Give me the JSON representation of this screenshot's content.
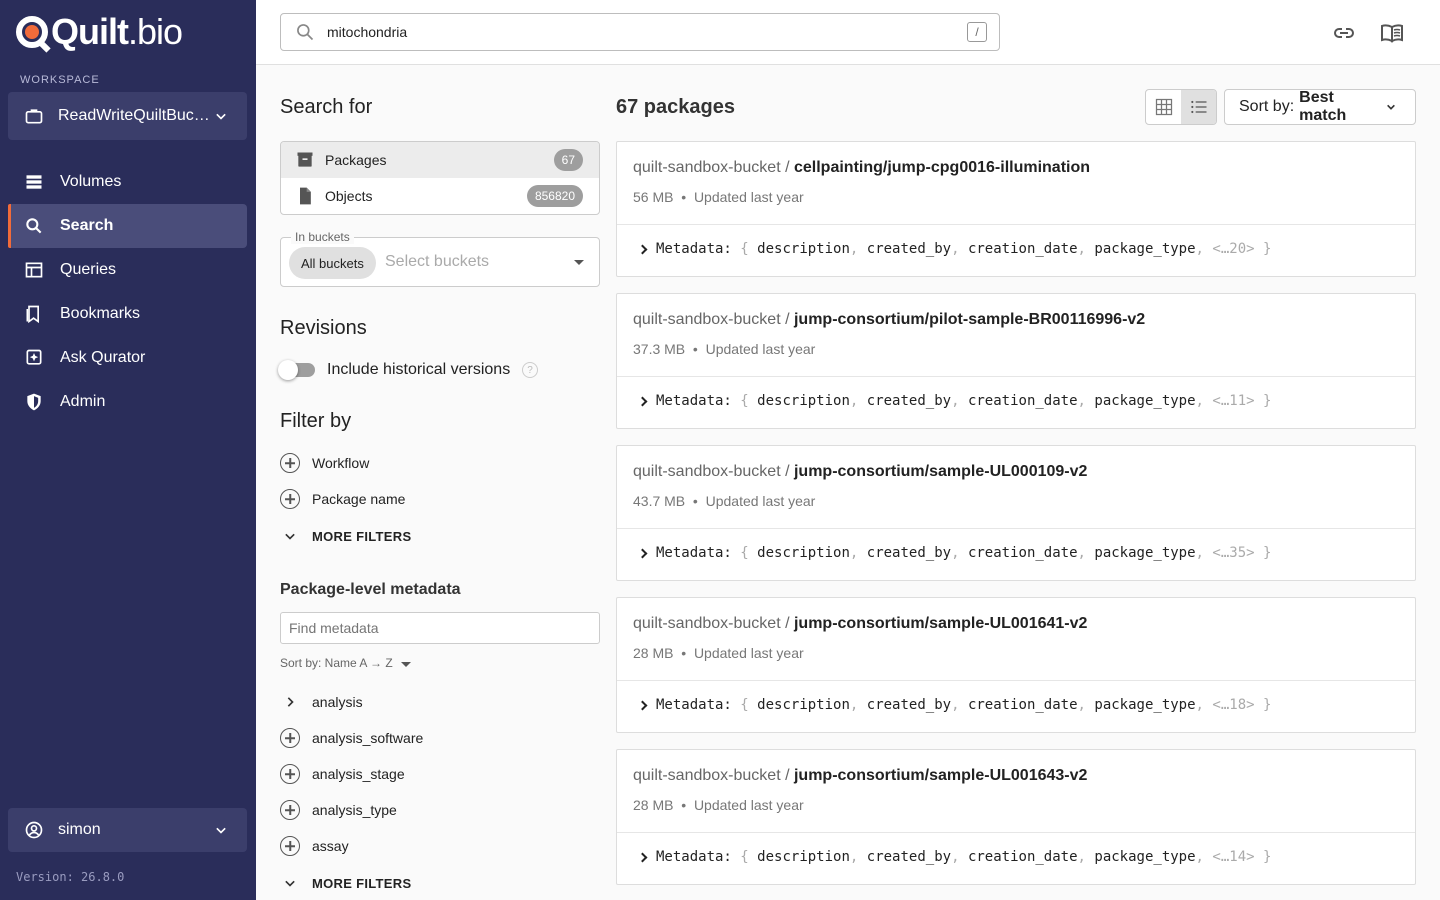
{
  "app": {
    "logo_brand": "Quilt",
    "logo_suffix": ".bio",
    "workspace_label": "WORKSPACE",
    "workspace_name": "ReadWriteQuiltBuck…",
    "version": "Version: 26.8.0"
  },
  "nav": [
    {
      "label": "Volumes",
      "icon": "volumes-icon"
    },
    {
      "label": "Search",
      "icon": "search-icon",
      "active": true
    },
    {
      "label": "Queries",
      "icon": "table-icon"
    },
    {
      "label": "Bookmarks",
      "icon": "bookmark-icon"
    },
    {
      "label": "Ask Qurator",
      "icon": "sparkle-icon"
    },
    {
      "label": "Admin",
      "icon": "shield-icon"
    }
  ],
  "user": {
    "name": "simon"
  },
  "search": {
    "value": "mitochondria",
    "shortcut": "/"
  },
  "filters": {
    "search_for_title": "Search for",
    "scopes": [
      {
        "label": "Packages",
        "count": "67",
        "selected": true
      },
      {
        "label": "Objects",
        "count": "856820",
        "selected": false
      }
    ],
    "buckets_legend": "In buckets",
    "buckets_chip": "All buckets",
    "buckets_placeholder": "Select buckets",
    "revisions_title": "Revisions",
    "historical_label": "Include historical versions",
    "historical_help": "?",
    "filter_by_title": "Filter by",
    "filter_items": [
      "Workflow",
      "Package name"
    ],
    "more_filters": "MORE FILTERS",
    "metadata_title": "Package-level metadata",
    "metadata_placeholder": "Find metadata",
    "metadata_sort": "Sort by: Name A → Z",
    "metadata_expandable": "analysis",
    "metadata_items": [
      "analysis_software",
      "analysis_stage",
      "analysis_type",
      "assay"
    ],
    "metadata_more": "MORE FILTERS"
  },
  "results": {
    "title": "67 packages",
    "sort_label": "Sort by:",
    "sort_value": "Best match",
    "metadata_label": "Metadata:",
    "metadata_keys": [
      "description",
      "created_by",
      "creation_date",
      "package_type"
    ],
    "cards": [
      {
        "bucket": "quilt-sandbox-bucket /",
        "name": "cellpainting/jump-cpg0016-illumination",
        "size": "56 MB",
        "updated": "Updated last year",
        "more": "<…20>"
      },
      {
        "bucket": "quilt-sandbox-bucket /",
        "name": "jump-consortium/pilot-sample-BR00116996-v2",
        "size": "37.3 MB",
        "updated": "Updated last year",
        "more": "<…11>"
      },
      {
        "bucket": "quilt-sandbox-bucket /",
        "name": "jump-consortium/sample-UL000109-v2",
        "size": "43.7 MB",
        "updated": "Updated last year",
        "more": "<…35>"
      },
      {
        "bucket": "quilt-sandbox-bucket /",
        "name": "jump-consortium/sample-UL001641-v2",
        "size": "28 MB",
        "updated": "Updated last year",
        "more": "<…18>"
      },
      {
        "bucket": "quilt-sandbox-bucket /",
        "name": "jump-consortium/sample-UL001643-v2",
        "size": "28 MB",
        "updated": "Updated last year",
        "more": "<…14>"
      }
    ]
  },
  "colors": {
    "sidebar_bg": "#2a2d5a",
    "accent": "#f26b3a"
  }
}
